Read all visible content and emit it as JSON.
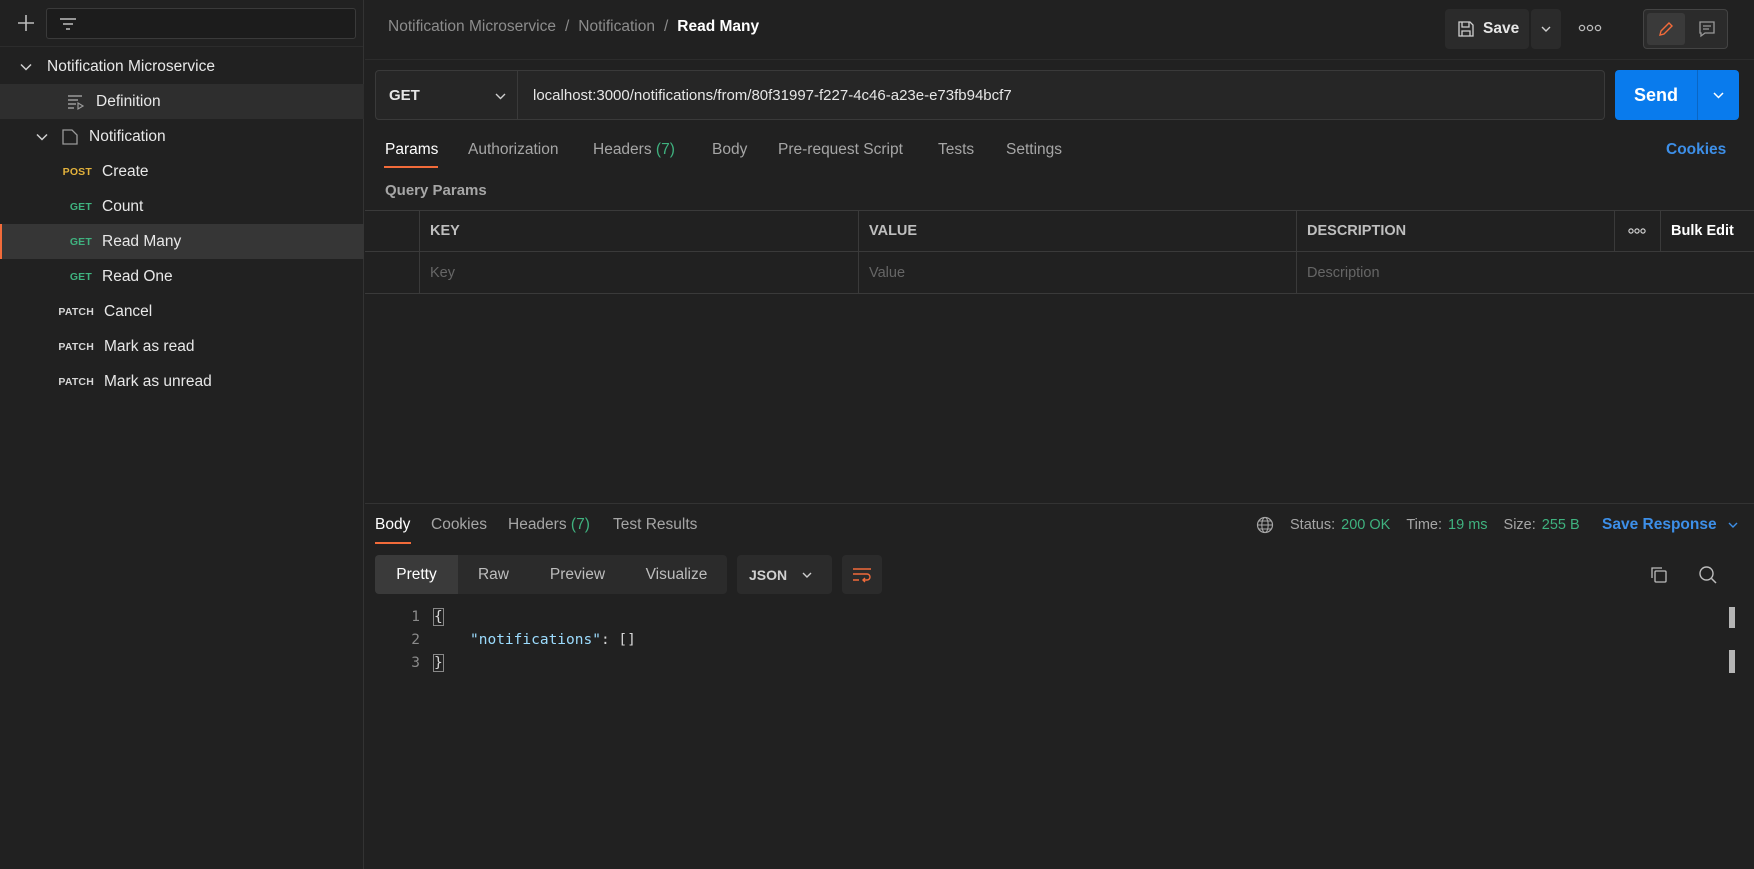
{
  "sidebar": {
    "collection": "Notification Microservice",
    "definition": "Definition",
    "folder": "Notification",
    "requests": [
      {
        "method": "POST",
        "name": "Create"
      },
      {
        "method": "GET",
        "name": "Count"
      },
      {
        "method": "GET",
        "name": "Read Many"
      },
      {
        "method": "GET",
        "name": "Read One"
      },
      {
        "method": "PATCH",
        "name": "Cancel"
      },
      {
        "method": "PATCH",
        "name": "Mark as read"
      },
      {
        "method": "PATCH",
        "name": "Mark as unread"
      }
    ]
  },
  "header": {
    "breadcrumb": [
      "Notification Microservice",
      "Notification",
      "Read Many"
    ],
    "separator": "/",
    "save_label": "Save"
  },
  "request": {
    "method": "GET",
    "url": "localhost:3000/notifications/from/80f31997-f227-4c46-a23e-e73fb94bcf7",
    "send_label": "Send",
    "tabs": [
      "Params",
      "Authorization",
      "Headers",
      "Body",
      "Pre-request Script",
      "Tests",
      "Settings"
    ],
    "headers_count": "(7)",
    "cookies_label": "Cookies",
    "query_params_title": "Query Params",
    "columns": [
      "KEY",
      "VALUE",
      "DESCRIPTION"
    ],
    "bulk_edit": "Bulk Edit",
    "placeholders": {
      "key": "Key",
      "value": "Value",
      "description": "Description"
    }
  },
  "response": {
    "tabs": [
      "Body",
      "Cookies",
      "Headers",
      "Test Results"
    ],
    "headers_count": "(7)",
    "status_label": "Status:",
    "status_value": "200 OK",
    "time_label": "Time:",
    "time_value": "19 ms",
    "size_label": "Size:",
    "size_value": "255 B",
    "save_response": "Save Response",
    "formats": [
      "Pretty",
      "Raw",
      "Preview",
      "Visualize"
    ],
    "language": "JSON",
    "lines": [
      {
        "n": "1",
        "text": "{"
      },
      {
        "n": "2",
        "key": "\"notifications\"",
        "rest": ": []"
      },
      {
        "n": "3",
        "text": "}"
      }
    ]
  },
  "colors": {
    "accent": "#f26b3a",
    "primary": "#097bed",
    "success": "#3fb27f",
    "post": "#e3b23c"
  }
}
